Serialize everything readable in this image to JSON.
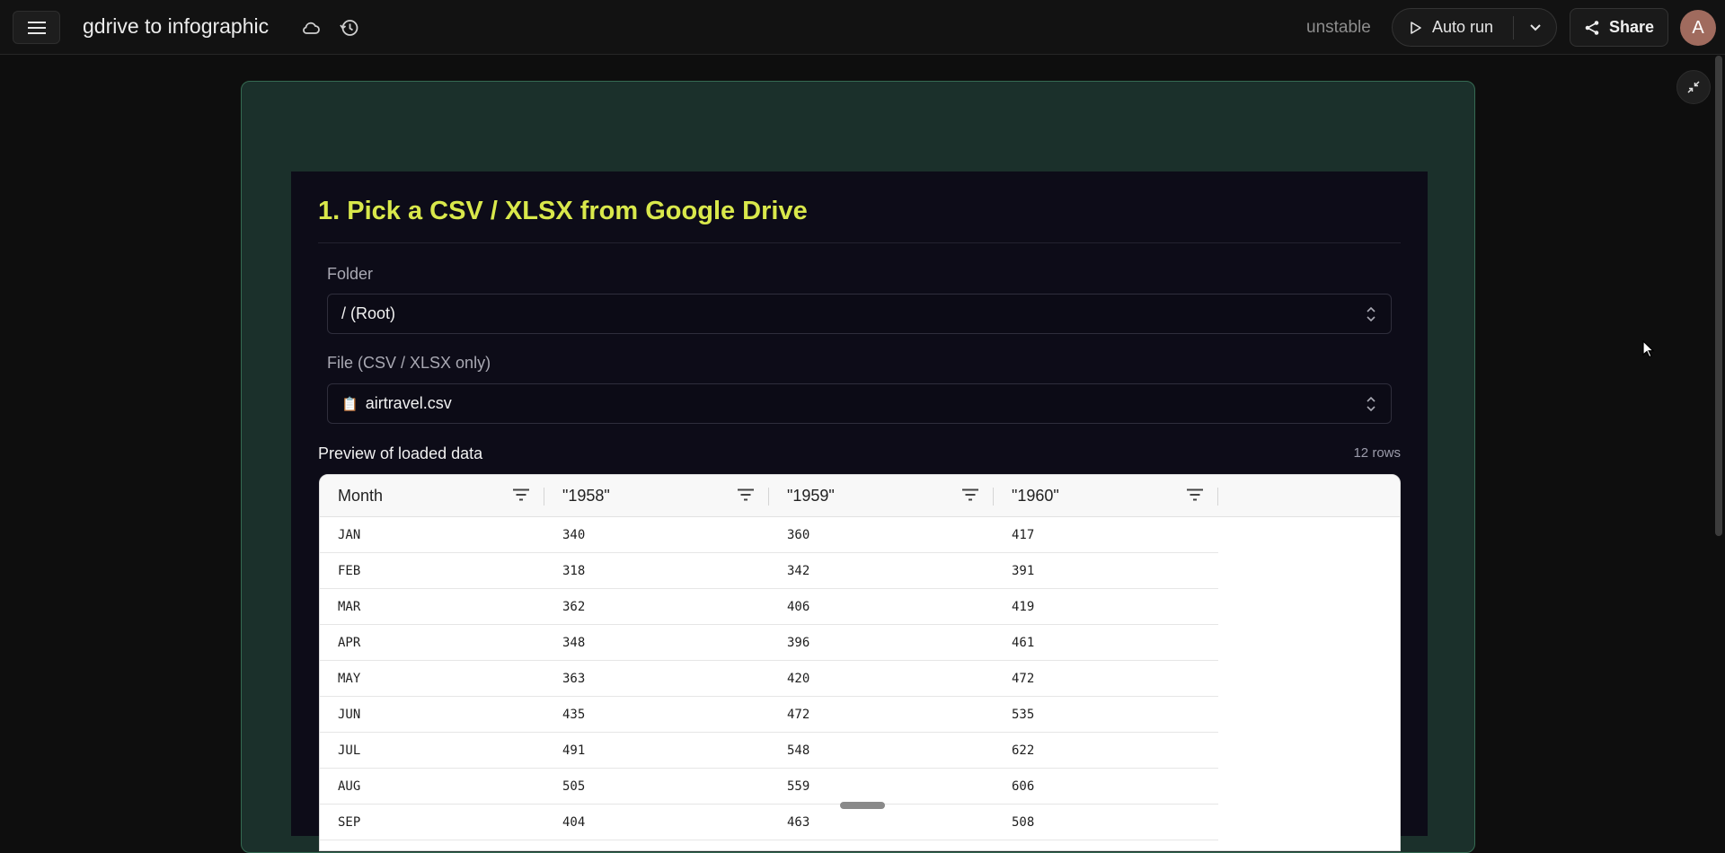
{
  "header": {
    "menu_icon": "hamburger-icon",
    "title": "gdrive to infographic",
    "cloud_icon": "cloud-icon",
    "history_icon": "history-icon",
    "status": "unstable",
    "autorun_label": "Auto run",
    "share_label": "Share",
    "avatar_initial": "A"
  },
  "section": {
    "title": "1. Pick a CSV / XLSX from Google Drive",
    "folder_label": "Folder",
    "folder_value": "/ (Root)",
    "file_label": "File (CSV / XLSX only)",
    "file_icon": "clipboard-icon",
    "file_value": "airtravel.csv",
    "preview_label": "Preview of loaded data",
    "row_count": "12 rows"
  },
  "table": {
    "columns": [
      "Month",
      "\"1958\"",
      "\"1959\"",
      "\"1960\""
    ],
    "rows": [
      [
        "JAN",
        "340",
        "360",
        "417"
      ],
      [
        "FEB",
        "318",
        "342",
        "391"
      ],
      [
        "MAR",
        "362",
        "406",
        "419"
      ],
      [
        "APR",
        "348",
        "396",
        "461"
      ],
      [
        "MAY",
        "363",
        "420",
        "472"
      ],
      [
        "JUN",
        "435",
        "472",
        "535"
      ],
      [
        "JUL",
        "491",
        "548",
        "622"
      ],
      [
        "AUG",
        "505",
        "559",
        "606"
      ],
      [
        "SEP",
        "404",
        "463",
        "508"
      ]
    ]
  },
  "colors": {
    "accent_title": "#d9e84b",
    "card_bg": "#1b302b",
    "panel_bg": "#0d0c18"
  }
}
